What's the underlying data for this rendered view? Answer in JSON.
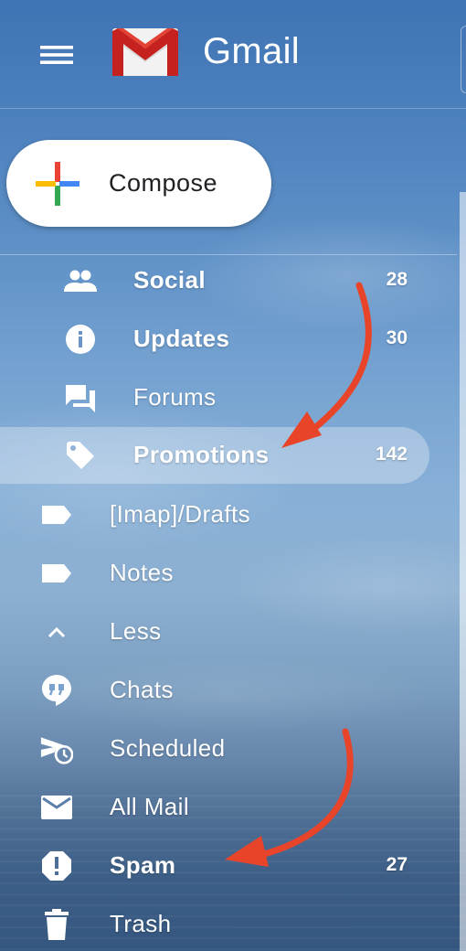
{
  "header": {
    "brand": "Gmail",
    "menu_icon": "hamburger-menu-icon",
    "logo_icon": "gmail-envelope-logo"
  },
  "compose": {
    "label": "Compose",
    "icon": "plus-multicolor-icon"
  },
  "categories": [
    {
      "label": "Social",
      "count": "28",
      "icon": "people-icon",
      "bold": true,
      "active": false
    },
    {
      "label": "Updates",
      "count": "30",
      "icon": "info-icon",
      "bold": true,
      "active": false
    },
    {
      "label": "Forums",
      "count": "",
      "icon": "forum-icon",
      "bold": false,
      "active": false
    },
    {
      "label": "Promotions",
      "count": "142",
      "icon": "tag-icon",
      "bold": true,
      "active": true
    }
  ],
  "folders": [
    {
      "label": "[Imap]/Drafts",
      "count": "",
      "icon": "label-icon",
      "bold": false
    },
    {
      "label": "Notes",
      "count": "",
      "icon": "label-icon",
      "bold": false
    },
    {
      "label": "Less",
      "count": "",
      "icon": "chevron-up-icon",
      "bold": false
    },
    {
      "label": "Chats",
      "count": "",
      "icon": "chat-quote-icon",
      "bold": false
    },
    {
      "label": "Scheduled",
      "count": "",
      "icon": "scheduled-send-icon",
      "bold": false
    },
    {
      "label": "All Mail",
      "count": "",
      "icon": "mail-icon",
      "bold": false
    },
    {
      "label": "Spam",
      "count": "27",
      "icon": "report-spam-icon",
      "bold": true
    },
    {
      "label": "Trash",
      "count": "",
      "icon": "trash-icon",
      "bold": false
    }
  ],
  "colors": {
    "annotation_arrow": "#e8442a",
    "active_highlight": "rgba(255,255,255,0.30)",
    "text": "#ffffff"
  }
}
